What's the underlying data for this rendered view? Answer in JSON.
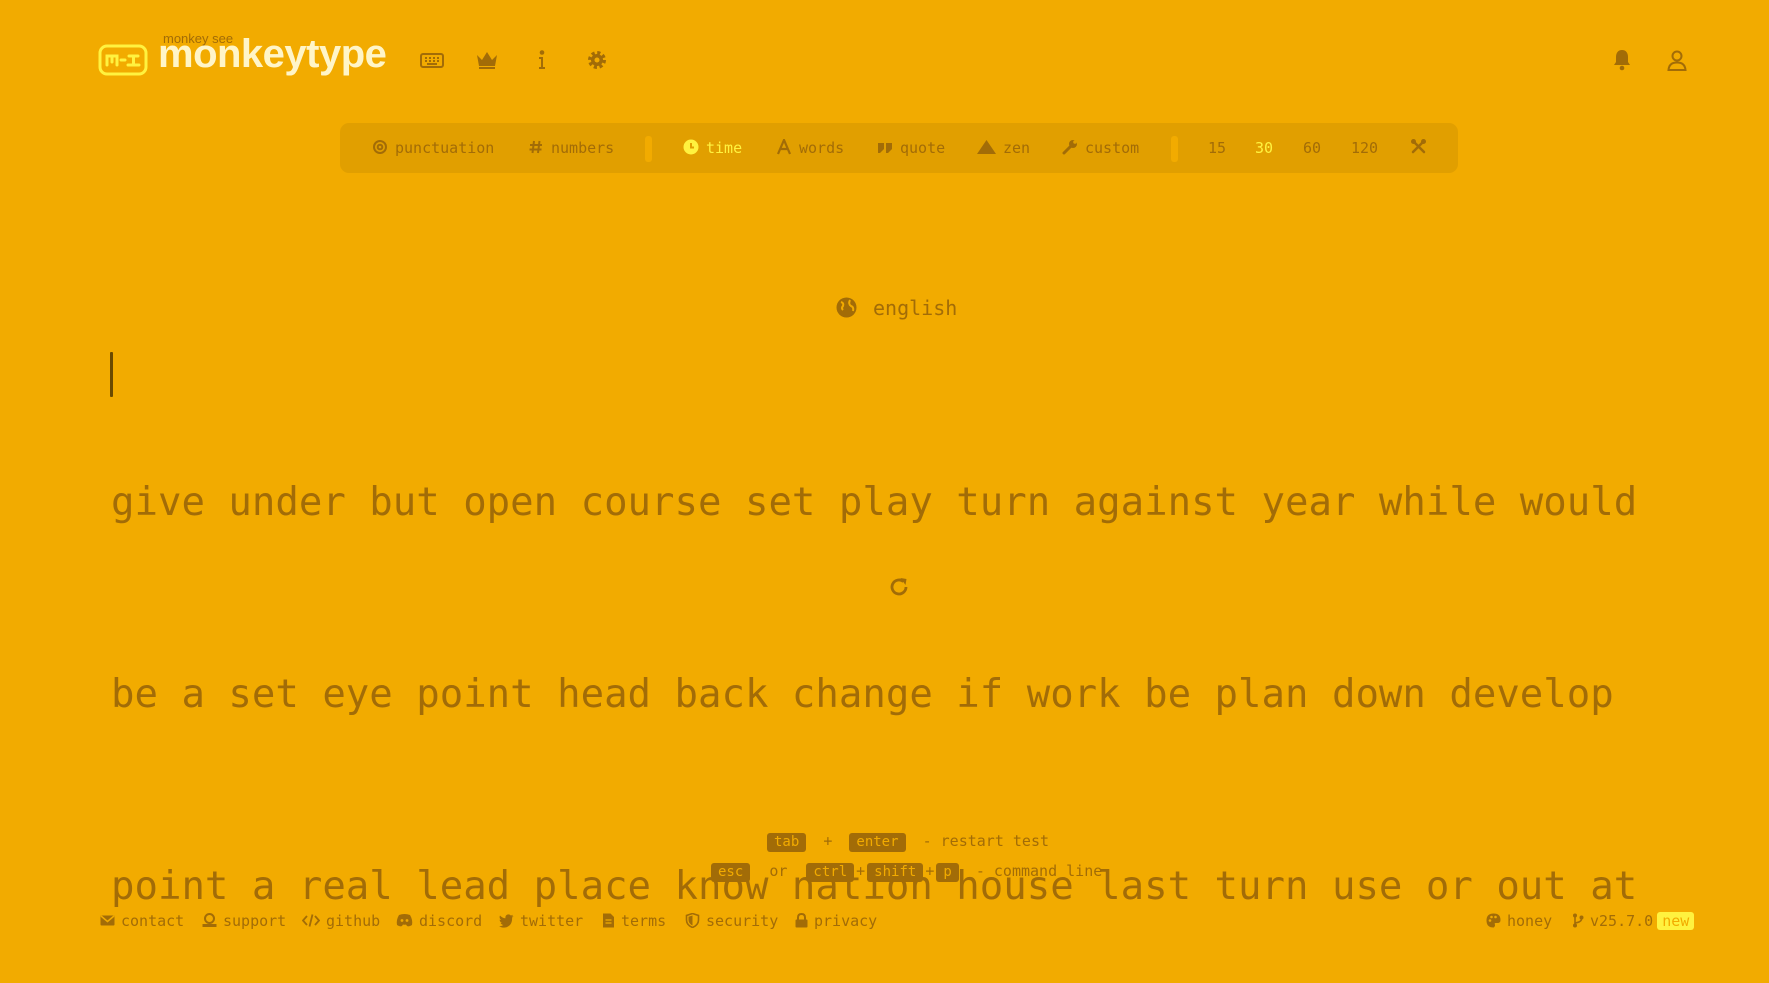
{
  "header": {
    "tagline": "monkey see",
    "title": "monkeytype",
    "nav": [
      "keyboard-icon",
      "crown-icon",
      "info-icon",
      "gear-icon"
    ]
  },
  "config": {
    "punctuation": "punctuation",
    "numbers": "numbers",
    "time": "time",
    "words": "words",
    "quote": "quote",
    "zen": "zen",
    "custom": "custom",
    "durations": [
      "15",
      "30",
      "60",
      "120"
    ],
    "active_mode": "time",
    "active_duration": "30"
  },
  "test": {
    "language": "english",
    "lines": [
      "give under but open course set play turn against year while would",
      "be a set eye point head back change if work be plan down develop",
      "point a real lead place know nation house last turn use or out at"
    ]
  },
  "shortcuts": {
    "restart": {
      "key1": "tab",
      "plus": "+",
      "key2": "enter",
      "label": "- restart test"
    },
    "command": {
      "key1": "esc",
      "or": "or",
      "key2": "ctrl",
      "plus1": "+",
      "key3": "shift",
      "plus2": "+",
      "key4": "p",
      "label": "- command line"
    }
  },
  "footer": {
    "links": [
      "contact",
      "support",
      "github",
      "discord",
      "twitter",
      "terms",
      "security",
      "privacy"
    ],
    "theme": "honey",
    "version": "v25.7.0",
    "new_badge": "new"
  },
  "colors": {
    "background": "#f2ab00",
    "main": "#fff23f",
    "sub": "#a26c07",
    "bar": "#e19f00"
  }
}
